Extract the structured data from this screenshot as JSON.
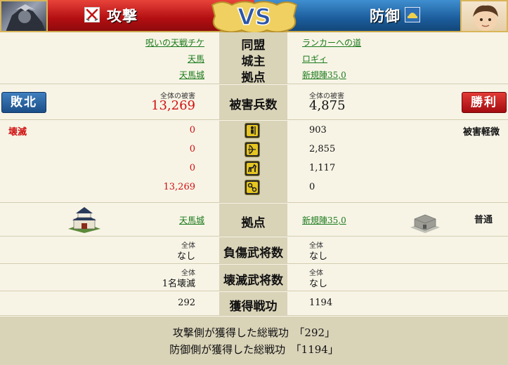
{
  "header": {
    "attack_title": "攻撃",
    "defense_title": "防御",
    "vs_label": "VS"
  },
  "info": {
    "alliance_label": "同盟",
    "castle_owner_label": "城主",
    "base_label": "拠点",
    "attacker_alliance": "呪いの天戦チケ",
    "attacker_owner": "天馬",
    "attacker_base": "天馬城",
    "defender_alliance": "ランカーへの道",
    "defender_owner": "ロギィ",
    "defender_base": "新規陣35,0"
  },
  "casualties": {
    "label": "被害兵数",
    "total_label": "全体の被害",
    "attacker_total": "13,269",
    "defender_total": "4,875",
    "attacker_result": "敗北",
    "defender_result": "勝利"
  },
  "units": {
    "attacker_status": "壊滅",
    "defender_status": "被害軽微",
    "rows": [
      {
        "icon": "infantry-icon",
        "attacker": "0",
        "defender": "903"
      },
      {
        "icon": "archer-icon",
        "attacker": "0",
        "defender": "2,855"
      },
      {
        "icon": "cavalry-icon",
        "attacker": "0",
        "defender": "1,117"
      },
      {
        "icon": "siege-icon",
        "attacker": "13,269",
        "defender": "0"
      }
    ]
  },
  "base_row": {
    "label": "拠点",
    "attacker_base": "天馬城",
    "defender_base": "新規陣35,0",
    "defender_status": "普通"
  },
  "injured": {
    "label": "負傷武将数",
    "total_label": "全体",
    "attacker": "なし",
    "defender": "なし"
  },
  "destroyed": {
    "label": "壊滅武将数",
    "total_label": "全体",
    "attacker": "1名壊滅",
    "defender": "なし"
  },
  "merit": {
    "label": "獲得戦功",
    "attacker": "292",
    "defender": "1194"
  },
  "footer": {
    "attacker_line": "攻撃側が獲得した総戦功　「292」",
    "defender_line": "防御側が獲得した総戦功　「1194」"
  },
  "colors": {
    "attack_red": "#b30f12",
    "defense_blue": "#1c5d9c",
    "loss_value": "#d01010",
    "link_green": "#1b7a1b",
    "vs_gold": "#e8c23a"
  }
}
